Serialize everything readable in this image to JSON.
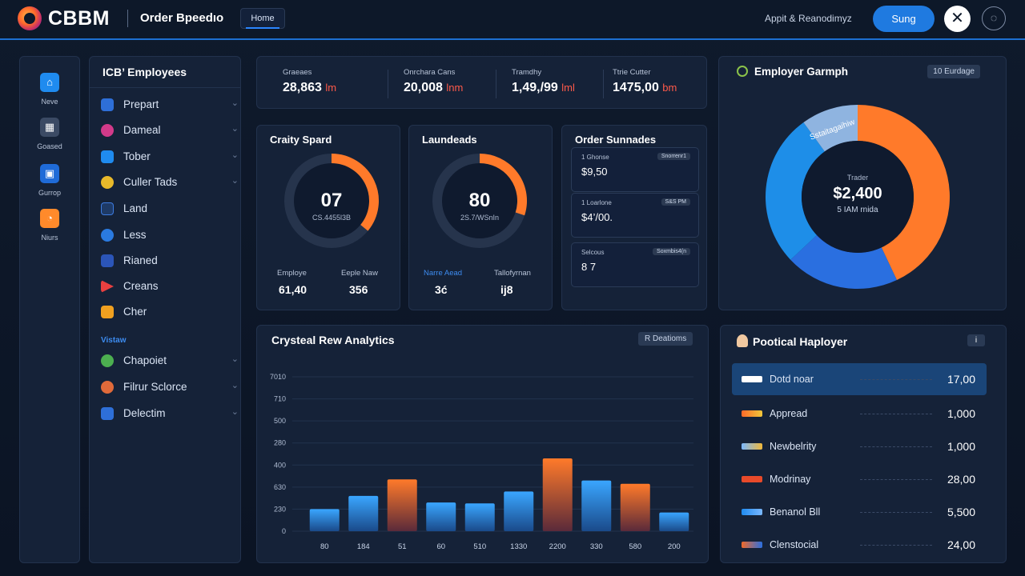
{
  "topbar": {
    "brand": "CBBM",
    "app_title": "Order Bpeedıo",
    "home_tab": "Home",
    "user_text": "Appit & Reanodimyz",
    "sign_button": "Sung",
    "close_icon": "close-icon",
    "bell_icon": "bell-icon"
  },
  "rail": {
    "items": [
      {
        "label": "Neve",
        "icon": "home-icon",
        "color": "#1f8bef"
      },
      {
        "label": "Goased",
        "icon": "grid-icon",
        "color": "#3b4a64"
      },
      {
        "label": "Gurrop",
        "icon": "group-icon",
        "color": "#1f6bd8"
      },
      {
        "label": "Niurs",
        "icon": "chart-icon",
        "color": "#ff8a2b"
      }
    ]
  },
  "employees": {
    "title": "ICB’ Employees",
    "items": [
      {
        "label": "Prepart",
        "color": "#2e6fd8",
        "chev": true
      },
      {
        "label": "Dameal",
        "color": "#d23a8a",
        "chev": true
      },
      {
        "label": "Tober",
        "color": "#1f8bef",
        "chev": true
      },
      {
        "label": "Culler Tads",
        "color": "#e8b92a",
        "chev": true
      },
      {
        "label": "Land",
        "color": "#1e3a66",
        "chev": false
      },
      {
        "label": "Less",
        "color": "#2a7ae0",
        "chev": false
      },
      {
        "label": "Rianed",
        "color": "#2b55b8",
        "chev": false
      },
      {
        "label": "Creans",
        "color": "#e84040",
        "chev": false
      },
      {
        "label": "Cher",
        "color": "#f0a020",
        "chev": false
      }
    ],
    "view_label": "Vistaw",
    "view_items": [
      {
        "label": "Chapoiet",
        "color": "#4caf50",
        "chev": true
      },
      {
        "label": "Filrur Sclorce",
        "color": "#e06a3a",
        "chev": true
      },
      {
        "label": "Delectim",
        "color": "#2e6fd8",
        "chev": true
      }
    ]
  },
  "stats": [
    {
      "label": "Graeaes",
      "value": "28,863",
      "unit": "lm"
    },
    {
      "label": "Onrchara Cans",
      "value": "20,008",
      "unit": "lnm"
    },
    {
      "label": "Tramdhy",
      "value": "1,49,/99",
      "unit": "lml"
    },
    {
      "label": "Ttrie Cutter",
      "value": "1475,00",
      "unit": "bm"
    }
  ],
  "gauge1": {
    "title": "Craity Spard",
    "value": "07",
    "sub": "CS.4455l3B",
    "fraction": 0.36,
    "foot": [
      {
        "label": "Employe",
        "value": "61,40"
      },
      {
        "label": "Eeple Naw",
        "value": "356"
      }
    ]
  },
  "gauge2": {
    "title": "Laundeads",
    "value": "80",
    "sub": "2S.7/WSnIn",
    "fraction": 0.3,
    "foot": [
      {
        "label": "Narre Aead",
        "value": "3ć",
        "blue": true
      },
      {
        "label": "Tallofyrnan",
        "value": "ĳ8"
      }
    ]
  },
  "order": {
    "title": "Order Sunnades",
    "rows": [
      {
        "label": "1 Ghonse",
        "value": "$9,50",
        "badge": "Snorrenr1"
      },
      {
        "label": "1 Loarlone",
        "value": "$4’/00.",
        "badge": "S&S PM"
      },
      {
        "label": "Selcous",
        "value": "8 7",
        "badge": "Soxmbis4(n"
      }
    ]
  },
  "donut": {
    "title": "Employer Garmph",
    "badge": "10 Eurdage",
    "center_label": "Trader",
    "center_value": "$2,400",
    "center_sub": "5 IAM rnida",
    "slice_label": "Sstaitagaihiw",
    "slices": [
      {
        "value": 43,
        "color": "#ff7a2a"
      },
      {
        "value": 20,
        "color": "#2a6fe0"
      },
      {
        "value": 27,
        "color": "#1e8ee8"
      },
      {
        "value": 10,
        "color": "#8fb4e0"
      }
    ]
  },
  "chart_data": {
    "type": "bar",
    "title": "Crysteal Rew Analytics",
    "badge": "R Deatioms",
    "categories": [
      "80",
      "184",
      "51",
      "60",
      "510",
      "1330",
      "2200",
      "330",
      "580",
      "200"
    ],
    "y_ticks": [
      "0",
      "230",
      "630",
      "400",
      "280",
      "500",
      "710",
      "7010"
    ],
    "values": [
      1.0,
      1.6,
      2.35,
      1.3,
      1.26,
      1.8,
      3.3,
      2.3,
      2.15,
      0.85
    ],
    "colors": [
      "blue",
      "blue",
      "orange",
      "blue",
      "blue",
      "blue",
      "orange",
      "blue",
      "orange",
      "blue"
    ],
    "ylim": [
      0,
      7
    ]
  },
  "popular": {
    "title": "Pootical Haployer",
    "info": "i",
    "rows": [
      {
        "label": "Dotd noar",
        "value": "17,00",
        "color": "#ffffff",
        "active": true
      },
      {
        "label": "Appread",
        "value": "1,000",
        "color": "#ff9a2a"
      },
      {
        "label": "Newbelrity",
        "value": "1,000",
        "color": "#f0b83a"
      },
      {
        "label": "Modrinay",
        "value": "28,00",
        "color": "#e84a2a"
      },
      {
        "label": "Benanol Bll",
        "value": "5,500",
        "color": "#1f8bef"
      },
      {
        "label": "Clenstocial",
        "value": "24,00",
        "color": "#f06a2a"
      }
    ]
  }
}
